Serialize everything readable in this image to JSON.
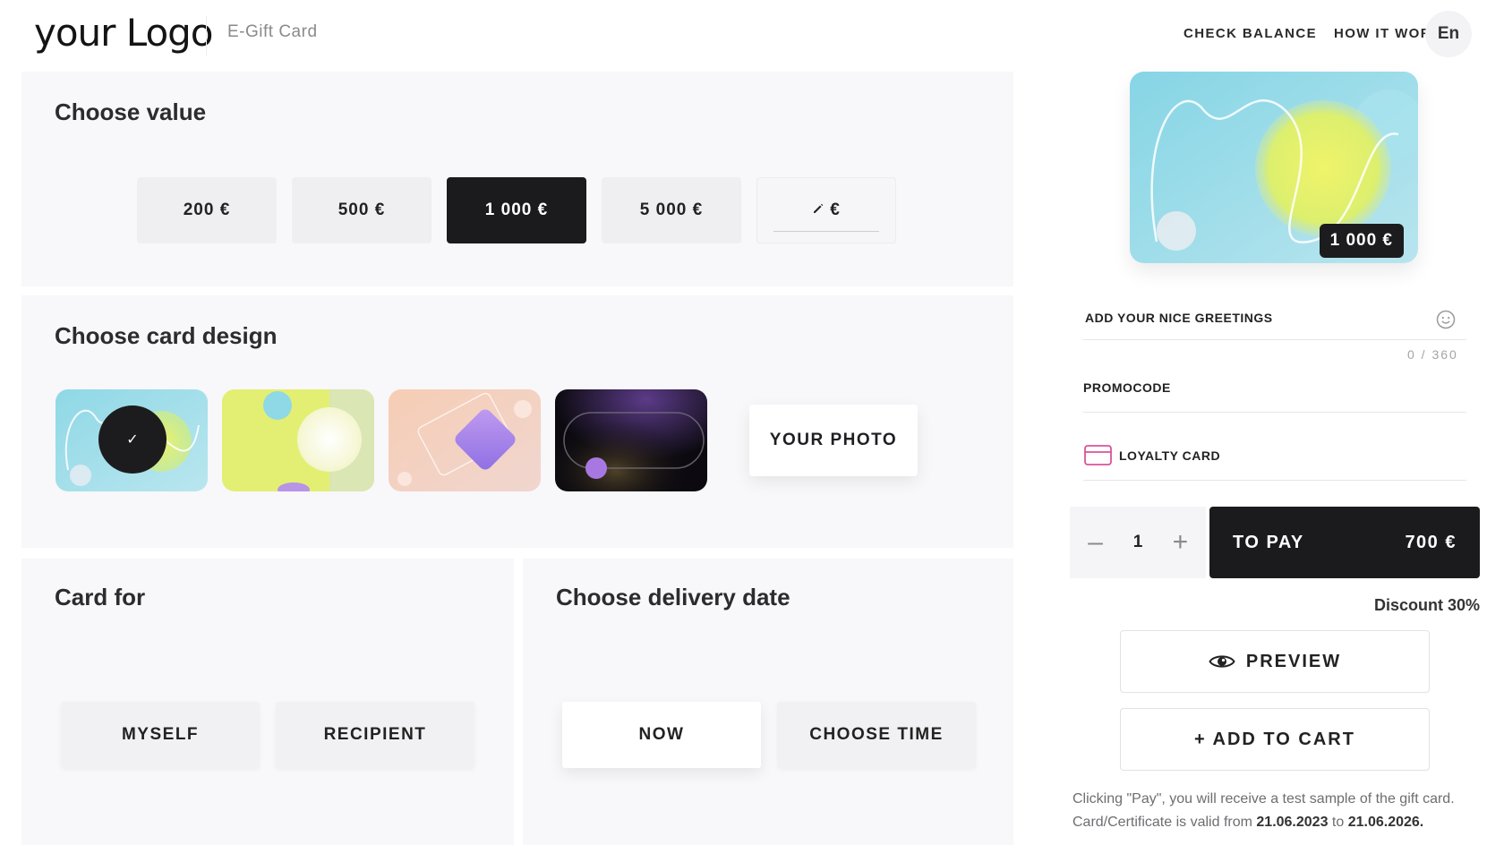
{
  "header": {
    "logo": "your Logo",
    "product": "E-Gift Card",
    "nav": [
      "CHECK BALANCE",
      "HOW IT WORKS"
    ],
    "language": "En"
  },
  "value_section": {
    "title": "Choose value",
    "options": [
      "200 €",
      "500 €",
      "1 000 €",
      "5 000 €"
    ],
    "selected": "1 000 €",
    "custom_suffix": "€"
  },
  "design_section": {
    "title": "Choose card design",
    "designs": [
      "design-aqua",
      "design-lime",
      "design-peach",
      "design-dark"
    ],
    "selected": "design-aqua",
    "photo_label": "YOUR PHOTO"
  },
  "card_for": {
    "title": "Card for",
    "options": [
      "MYSELF",
      "RECIPIENT"
    ]
  },
  "delivery": {
    "title": "Choose delivery date",
    "options": [
      "NOW",
      "CHOOSE TIME"
    ],
    "selected": "NOW"
  },
  "summary": {
    "card_amount": "1 000 €",
    "greetings_label": "ADD YOUR NICE GREETINGS",
    "greetings_counter": "0 / 360",
    "promocode_label": "PROMOCODE",
    "loyalty_label": "LOYALTY CARD",
    "quantity": "1",
    "pay_label": "TO PAY",
    "pay_amount": "700 €",
    "discount": "Discount 30%",
    "preview_label": "PREVIEW",
    "add_to_cart_label": "+ ADD TO CART",
    "note_prefix": "Clicking \"Pay\", you will receive a test sample of the gift card. Card/Certificate is valid from ",
    "valid_from": "21.06.2023",
    "note_middle": " to ",
    "valid_to": "21.06.2026",
    "note_suffix": "."
  },
  "colors": {
    "accent_dark": "#1b1b1d",
    "panel_bg": "#f8f7f9",
    "loyalty_icon": "#d9539a"
  },
  "icons": [
    "pencil-icon",
    "check-icon",
    "smiley-icon",
    "loyalty-card-icon",
    "minus-icon",
    "plus-icon",
    "eye-icon"
  ]
}
